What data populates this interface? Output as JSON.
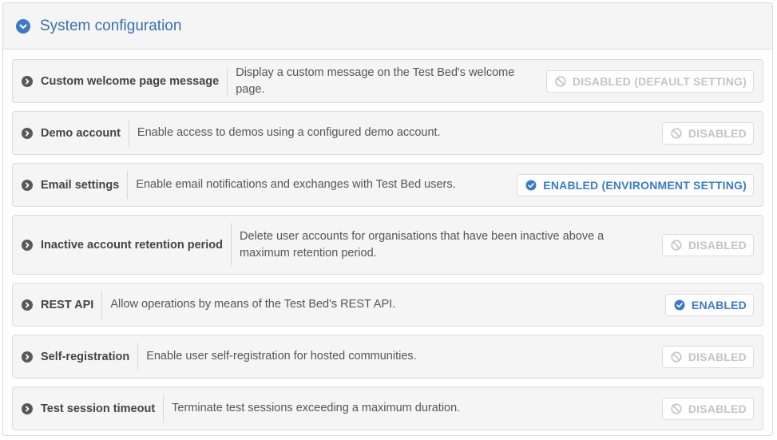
{
  "panel": {
    "title": "System configuration",
    "icon": "chevron-down-circle-icon",
    "accent_color": "#3a7bc8"
  },
  "settings": [
    {
      "title": "Custom welcome page message",
      "description": "Display a custom message on the Test Bed's welcome page.",
      "status": "DISABLED (DEFAULT SETTING)",
      "enabled": false
    },
    {
      "title": "Demo account",
      "description": "Enable access to demos using a configured demo account.",
      "status": "DISABLED",
      "enabled": false
    },
    {
      "title": "Email settings",
      "description": "Enable email notifications and exchanges with Test Bed users.",
      "status": "ENABLED (ENVIRONMENT SETTING)",
      "enabled": true
    },
    {
      "title": "Inactive account retention period",
      "description": "Delete user accounts for organisations that have been inactive above a maximum retention period.",
      "status": "DISABLED",
      "enabled": false
    },
    {
      "title": "REST API",
      "description": "Allow operations by means of the Test Bed's REST API.",
      "status": "ENABLED",
      "enabled": true
    },
    {
      "title": "Self-registration",
      "description": "Enable user self-registration for hosted communities.",
      "status": "DISABLED",
      "enabled": false
    },
    {
      "title": "Test session timeout",
      "description": "Terminate test sessions exceeding a maximum duration.",
      "status": "DISABLED",
      "enabled": false
    }
  ]
}
